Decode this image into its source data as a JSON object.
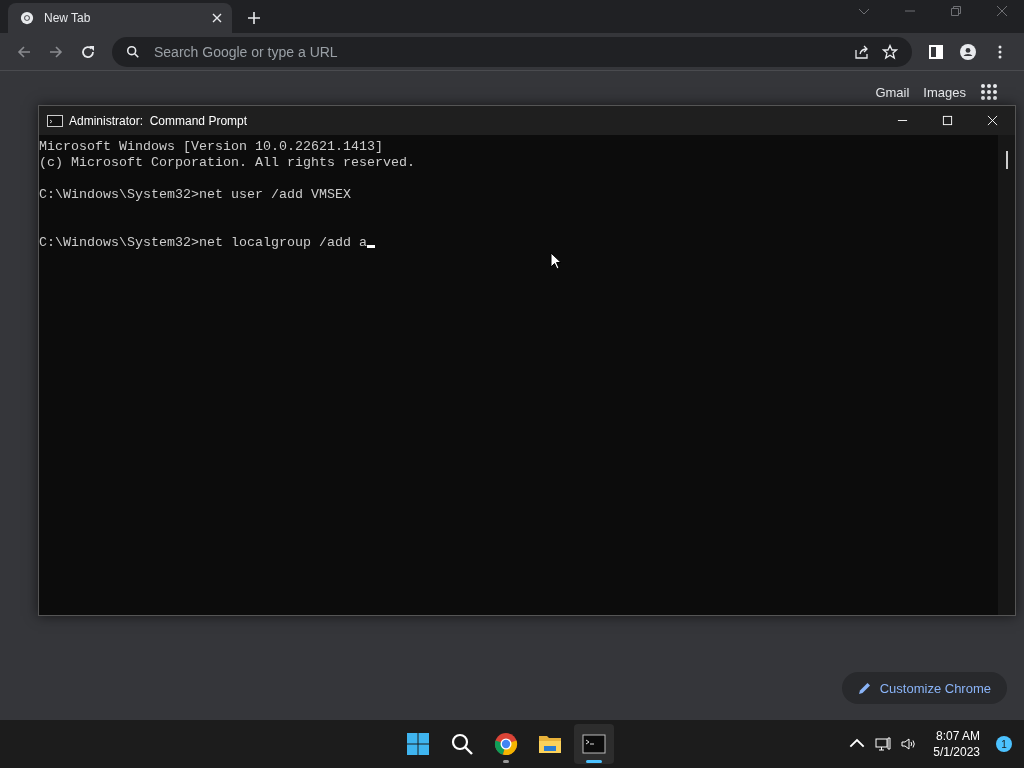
{
  "browser": {
    "tab": {
      "title": "New Tab",
      "selected": true
    },
    "omnibox": {
      "placeholder": "Search Google or type a URL"
    },
    "forward_disabled": true
  },
  "page": {
    "links": [
      "Gmail",
      "Images"
    ],
    "customize": "Customize Chrome"
  },
  "console": {
    "title": "Administrator:  Command Prompt",
    "lines": [
      {
        "kind": "text",
        "text": "Microsoft Windows [Version 10.0.22621.1413]"
      },
      {
        "kind": "text",
        "text": "(c) Microsoft Corporation. All rights reserved."
      },
      {
        "kind": "blank"
      },
      {
        "kind": "text",
        "text": "C:\\Windows\\System32>net user /add VMSEX"
      },
      {
        "kind": "blank"
      },
      {
        "kind": "blank"
      },
      {
        "kind": "prompt",
        "text": "C:\\Windows\\System32>net localgroup /add a"
      }
    ]
  },
  "taskbar": {
    "apps": [
      {
        "kind": "start",
        "running": false,
        "selected": false
      },
      {
        "kind": "search",
        "running": false,
        "selected": false
      },
      {
        "kind": "chrome",
        "running": true,
        "selected": false
      },
      {
        "kind": "explorer",
        "running": false,
        "selected": false
      },
      {
        "kind": "terminal",
        "running": true,
        "selected": true
      }
    ],
    "time": "8:07 AM",
    "date": "5/1/2023",
    "notifications": "1"
  }
}
